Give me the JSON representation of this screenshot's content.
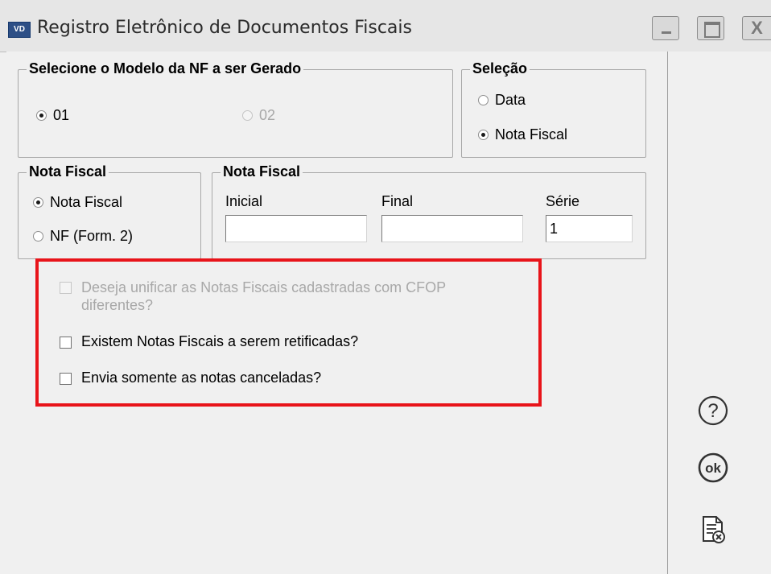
{
  "window": {
    "icon_text": "VD",
    "title": "Registro Eletrônico de Documentos Fiscais",
    "buttons": {
      "minimize": "minimize-icon",
      "maximize": "maximize-icon",
      "close": "X"
    }
  },
  "modelo_group": {
    "title": "Selecione o Modelo da NF a ser Gerado",
    "options": [
      {
        "label": "01",
        "selected": true,
        "enabled": true
      },
      {
        "label": "02",
        "selected": false,
        "enabled": false
      }
    ]
  },
  "selecao_group": {
    "title": "Seleção",
    "options": [
      {
        "label": "Data",
        "selected": false
      },
      {
        "label": "Nota Fiscal",
        "selected": true
      }
    ]
  },
  "nota_fiscal_type_group": {
    "title": "Nota Fiscal",
    "options": [
      {
        "label": "Nota Fiscal",
        "selected": true
      },
      {
        "label": "NF (Form. 2)",
        "selected": false
      }
    ]
  },
  "nota_fiscal_range_group": {
    "title": "Nota Fiscal",
    "inicial": {
      "label": "Inicial",
      "value": ""
    },
    "final": {
      "label": "Final",
      "value": ""
    },
    "serie": {
      "label": "Série",
      "value": "1"
    }
  },
  "options": {
    "unificar_line1": "Deseja unificar as Notas Fiscais cadastradas com CFOP",
    "unificar_line2": "diferentes?",
    "retificadas": "Existem Notas Fiscais a serem retificadas?",
    "canceladas": "Envia somente as notas canceladas?"
  },
  "side_buttons": {
    "help": "?",
    "ok": "ok",
    "cancel": "cancel-document-icon"
  },
  "colors": {
    "highlight": "#e8141a",
    "title_icon": "#2d4f86"
  }
}
